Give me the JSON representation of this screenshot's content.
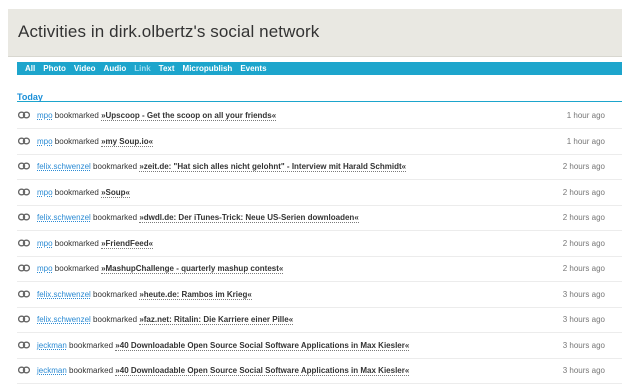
{
  "header": {
    "title": "Activities in dirk.olbertz's social network"
  },
  "tabs": [
    "All",
    "Photo",
    "Video",
    "Audio",
    "Link",
    "Text",
    "Micropublish",
    "Events"
  ],
  "active_tab": "Link",
  "section_label": "Today",
  "items": [
    {
      "user": "mpo",
      "verb": "bookmarked",
      "title": "»Upscoop - Get the scoop on all your friends«",
      "time": "1 hour ago"
    },
    {
      "user": "mpo",
      "verb": "bookmarked",
      "title": "»my Soup.io«",
      "time": "1 hour ago"
    },
    {
      "user": "felix.schwenzel",
      "verb": "bookmarked",
      "title": "»zeit.de: \"Hat sich alles nicht gelohnt\" - Interview mit Harald Schmidt«",
      "time": "2 hours ago"
    },
    {
      "user": "mpo",
      "verb": "bookmarked",
      "title": "»Soup«",
      "time": "2 hours ago"
    },
    {
      "user": "felix.schwenzel",
      "verb": "bookmarked",
      "title": "»dwdl.de: Der iTunes-Trick: Neue US-Serien downloaden«",
      "time": "2 hours ago"
    },
    {
      "user": "mpo",
      "verb": "bookmarked",
      "title": "»FriendFeed«",
      "time": "2 hours ago"
    },
    {
      "user": "mpo",
      "verb": "bookmarked",
      "title": "»MashupChallenge - quarterly mashup contest«",
      "time": "2 hours ago"
    },
    {
      "user": "felix.schwenzel",
      "verb": "bookmarked",
      "title": "»heute.de: Rambos im Krieg«",
      "time": "3 hours ago"
    },
    {
      "user": "felix.schwenzel",
      "verb": "bookmarked",
      "title": "»faz.net: Ritalin: Die Karriere einer Pille«",
      "time": "3 hours ago"
    },
    {
      "user": "jeckman",
      "verb": "bookmarked",
      "title": "»40 Downloadable Open Source Social Software Applications in Max Kiesler«",
      "time": "3 hours ago"
    },
    {
      "user": "jeckman",
      "verb": "bookmarked",
      "title": "»40 Downloadable Open Source Social Software Applications in Max Kiesler«",
      "time": "3 hours ago"
    }
  ],
  "colors": {
    "accent": "#1da5cc",
    "link": "#2b8bd4",
    "header_bg": "#e9e8e2"
  }
}
